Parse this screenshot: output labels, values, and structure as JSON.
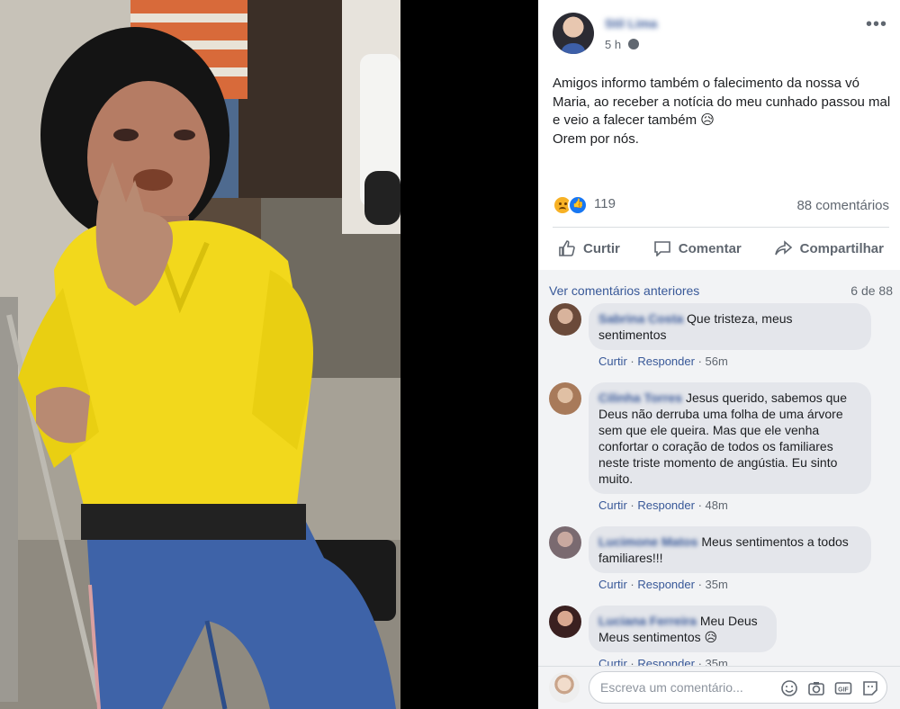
{
  "post": {
    "author": "Stil Lima",
    "time": "5 h",
    "text_lines": [
      "Amigos informo também o falecimento da nossa vó Maria, ao receber a notícia do meu cunhado passou mal e veio a falecer também 😥",
      "Orem por nós."
    ]
  },
  "reactions": {
    "count": "119",
    "comments": "88 comentários"
  },
  "actions": {
    "like": "Curtir",
    "comment": "Comentar",
    "share": "Compartilhar"
  },
  "comments_section": {
    "prev_link": "Ver comentários anteriores",
    "count": "6 de 88",
    "like_label": "Curtir",
    "reply_label": "Responder",
    "items": [
      {
        "name": "Sabrina Costa",
        "text": "Que tristeza, meus sentimentos",
        "time": "56m"
      },
      {
        "name": "Cilinha Torres",
        "text": "Jesus querido, sabemos que Deus não derruba uma folha de uma árvore sem que ele queira. Mas que ele venha confortar o coração de todos os familiares neste triste momento de angústia. Eu sinto muito.",
        "time": "48m"
      },
      {
        "name": "Lucimone Matos",
        "text": "Meus sentimentos a todos familiares!!!",
        "time": "35m"
      },
      {
        "name": "Luciana Ferreira",
        "text": "Meu Deus Meus sentimentos 😥",
        "time": "35m"
      }
    ]
  },
  "composer": {
    "placeholder": "Escreva um comentário..."
  },
  "colors": {
    "link": "#385898",
    "muted": "#606770",
    "bubble": "#e4e6eb",
    "sweater": "#f2d81c",
    "jeans": "#3e63a8"
  }
}
